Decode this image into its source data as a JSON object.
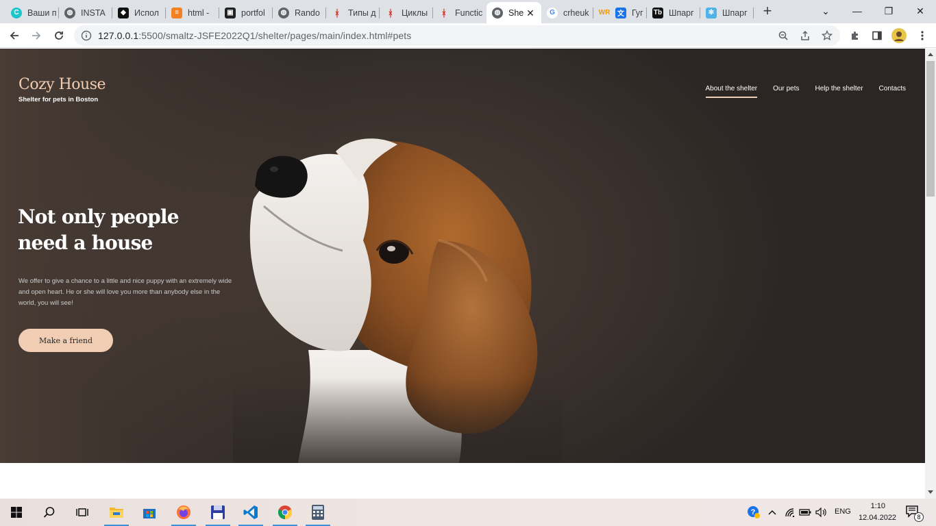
{
  "browser": {
    "tabs": [
      {
        "title": "Ваши п",
        "icon": "canva-icon"
      },
      {
        "title": "INSTA",
        "icon": "globe-icon"
      },
      {
        "title": "Испол",
        "icon": "codepen-icon"
      },
      {
        "title": "html -",
        "icon": "stackoverflow-icon"
      },
      {
        "title": "portfol",
        "icon": "portfolio-icon"
      },
      {
        "title": "Rando",
        "icon": "globe-icon"
      },
      {
        "title": "Типы д",
        "icon": "js-tutorial-icon"
      },
      {
        "title": "Циклы",
        "icon": "js-tutorial-icon"
      },
      {
        "title": "Functic",
        "icon": "js-tutorial-icon"
      },
      {
        "title": "She",
        "icon": "globe-icon",
        "active": true
      },
      {
        "title": "crheuk",
        "icon": "google-icon"
      },
      {
        "title": "",
        "icon": "wr-icon"
      },
      {
        "title": "Гуг",
        "icon": "translate-icon"
      },
      {
        "title": "Шпарг",
        "icon": "tb-icon"
      },
      {
        "title": "Шпарг",
        "icon": "snowflake-icon"
      }
    ],
    "close_symbol": "✕",
    "new_tab_symbol": "+",
    "window_controls": {
      "minimize": "—",
      "restore": "❐",
      "close": "✕",
      "tab_search": "⌄"
    },
    "url_host": "127.0.0.1",
    "url_path": ":5500/smaltz-JSFE2022Q1/shelter/pages/main/index.html#pets"
  },
  "page": {
    "logo": "Cozy House",
    "tagline": "Shelter for pets in Boston",
    "nav": [
      "About the shelter",
      "Our pets",
      "Help the shelter",
      "Contacts"
    ],
    "headline_line1": "Not only people",
    "headline_line2": "need a house",
    "description": "We offer to give a chance to a little and nice puppy with an extremely wide and open heart. He or she will love you more than anybody else in the world, you will see!",
    "cta": "Make a friend"
  },
  "taskbar": {
    "apps": [
      "windows-start-icon",
      "search-icon",
      "task-view-icon",
      "file-explorer-icon",
      "store-icon",
      "firefox-icon",
      "save-app-icon",
      "vscode-icon",
      "chrome-icon",
      "calculator-icon"
    ],
    "lang": "ENG",
    "time": "1:10",
    "date": "12.04.2022",
    "notifications": "8"
  },
  "colors": {
    "accent": "#f1cdb3",
    "hero_dark": "#292524",
    "tabstrip": "#dee1e6"
  }
}
